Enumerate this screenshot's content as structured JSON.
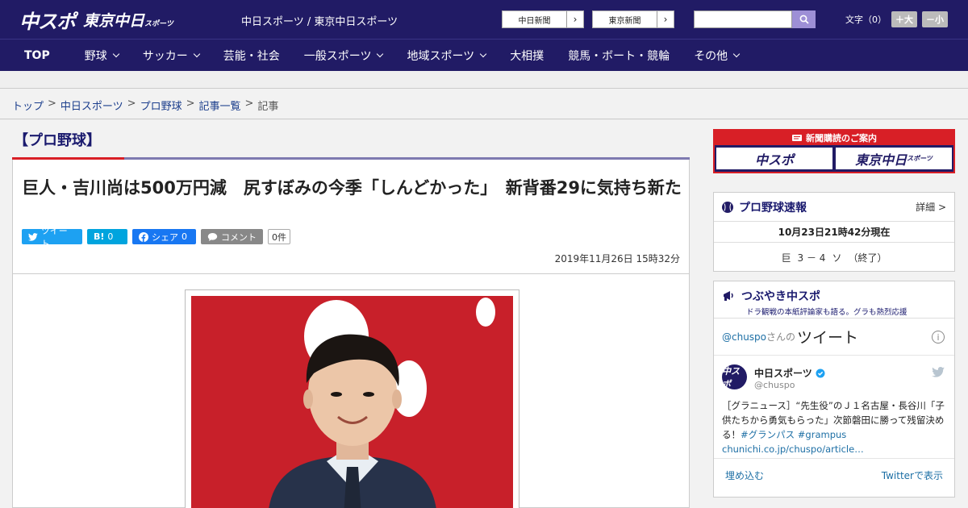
{
  "header": {
    "logo_main": "中スポ",
    "logo_tokyo": "東京中日",
    "logo_tokyo_small": "スポーツ",
    "site_link": "中日スポーツ / 東京中日スポーツ",
    "ext_buttons": [
      {
        "label": "中日新聞",
        "arrow": "›"
      },
      {
        "label": "東京新聞",
        "arrow": "›"
      }
    ],
    "search": {
      "placeholder": ""
    },
    "font_size_label": "文字（0）",
    "font_larger": "＋大",
    "font_smaller": "－小"
  },
  "nav": {
    "items": [
      {
        "label": "TOP",
        "has_dropdown": false
      },
      {
        "label": "野球",
        "has_dropdown": true
      },
      {
        "label": "サッカー",
        "has_dropdown": true
      },
      {
        "label": "芸能・社会",
        "has_dropdown": false
      },
      {
        "label": "一般スポーツ",
        "has_dropdown": true
      },
      {
        "label": "地域スポーツ",
        "has_dropdown": true
      },
      {
        "label": "大相撲",
        "has_dropdown": false
      },
      {
        "label": "競馬・ボート・競輪",
        "has_dropdown": false
      },
      {
        "label": "その他",
        "has_dropdown": true
      }
    ]
  },
  "breadcrumb": {
    "items": [
      "トップ",
      "中日スポーツ",
      "プロ野球",
      "記事一覧"
    ],
    "separator": ">",
    "current": "記事"
  },
  "section": {
    "title": "【プロ野球】"
  },
  "article": {
    "headline": "巨人・吉川尚は500万円減　尻すぼみの今季「しんどかった」　新背番29に気持ち新た",
    "share": {
      "tweet_label": "ツイート",
      "hatena_label": "B!",
      "hatena_count": "0",
      "facebook_label": "シェア",
      "facebook_count": "0",
      "comment_label": "コメント",
      "comment_count": "0件"
    },
    "date": "2019年11月26日 15時32分"
  },
  "sidebar": {
    "ad": {
      "title": "新聞購読のご案内",
      "left": "中スポ",
      "right": "東京中日",
      "right_small": "スポーツ"
    },
    "scores": {
      "title": "プロ野球速報",
      "more": "詳細 >",
      "timestamp": "10月23日21時42分現在",
      "team_home": "巨",
      "score": "3 － 4",
      "team_away": "ソ",
      "status": "（終了）"
    },
    "tsubuyaki": {
      "title": "つぶやき中スポ",
      "subtitle": "ドラ観戦の本紙評論家も語る。グラも熱烈応援",
      "tw_handle_prefix": "@chuspo",
      "tw_handle_suffix": "さんの",
      "tw_title": "ツイート",
      "tweet": {
        "avatar_text": "中スポ",
        "name": "中日スポーツ",
        "handle": "@chuspo",
        "text_prefix": "［グラニュース］“先生役”のＪ１名古屋・長谷川「子供たちから勇気もらった」次節磐田に勝って残留決める！",
        "hashtag1": "#グランパス",
        "hashtag2": "#grampus",
        "link": "chunichi.co.jp/chuspo/article…"
      },
      "embed_label": "埋め込む",
      "view_on_twitter": "Twitterで表示"
    }
  },
  "colors": {
    "brand_navy": "#211b65",
    "accent_red": "#d81f26",
    "twitter_blue": "#1da1f2",
    "facebook_blue": "#1877f2"
  }
}
